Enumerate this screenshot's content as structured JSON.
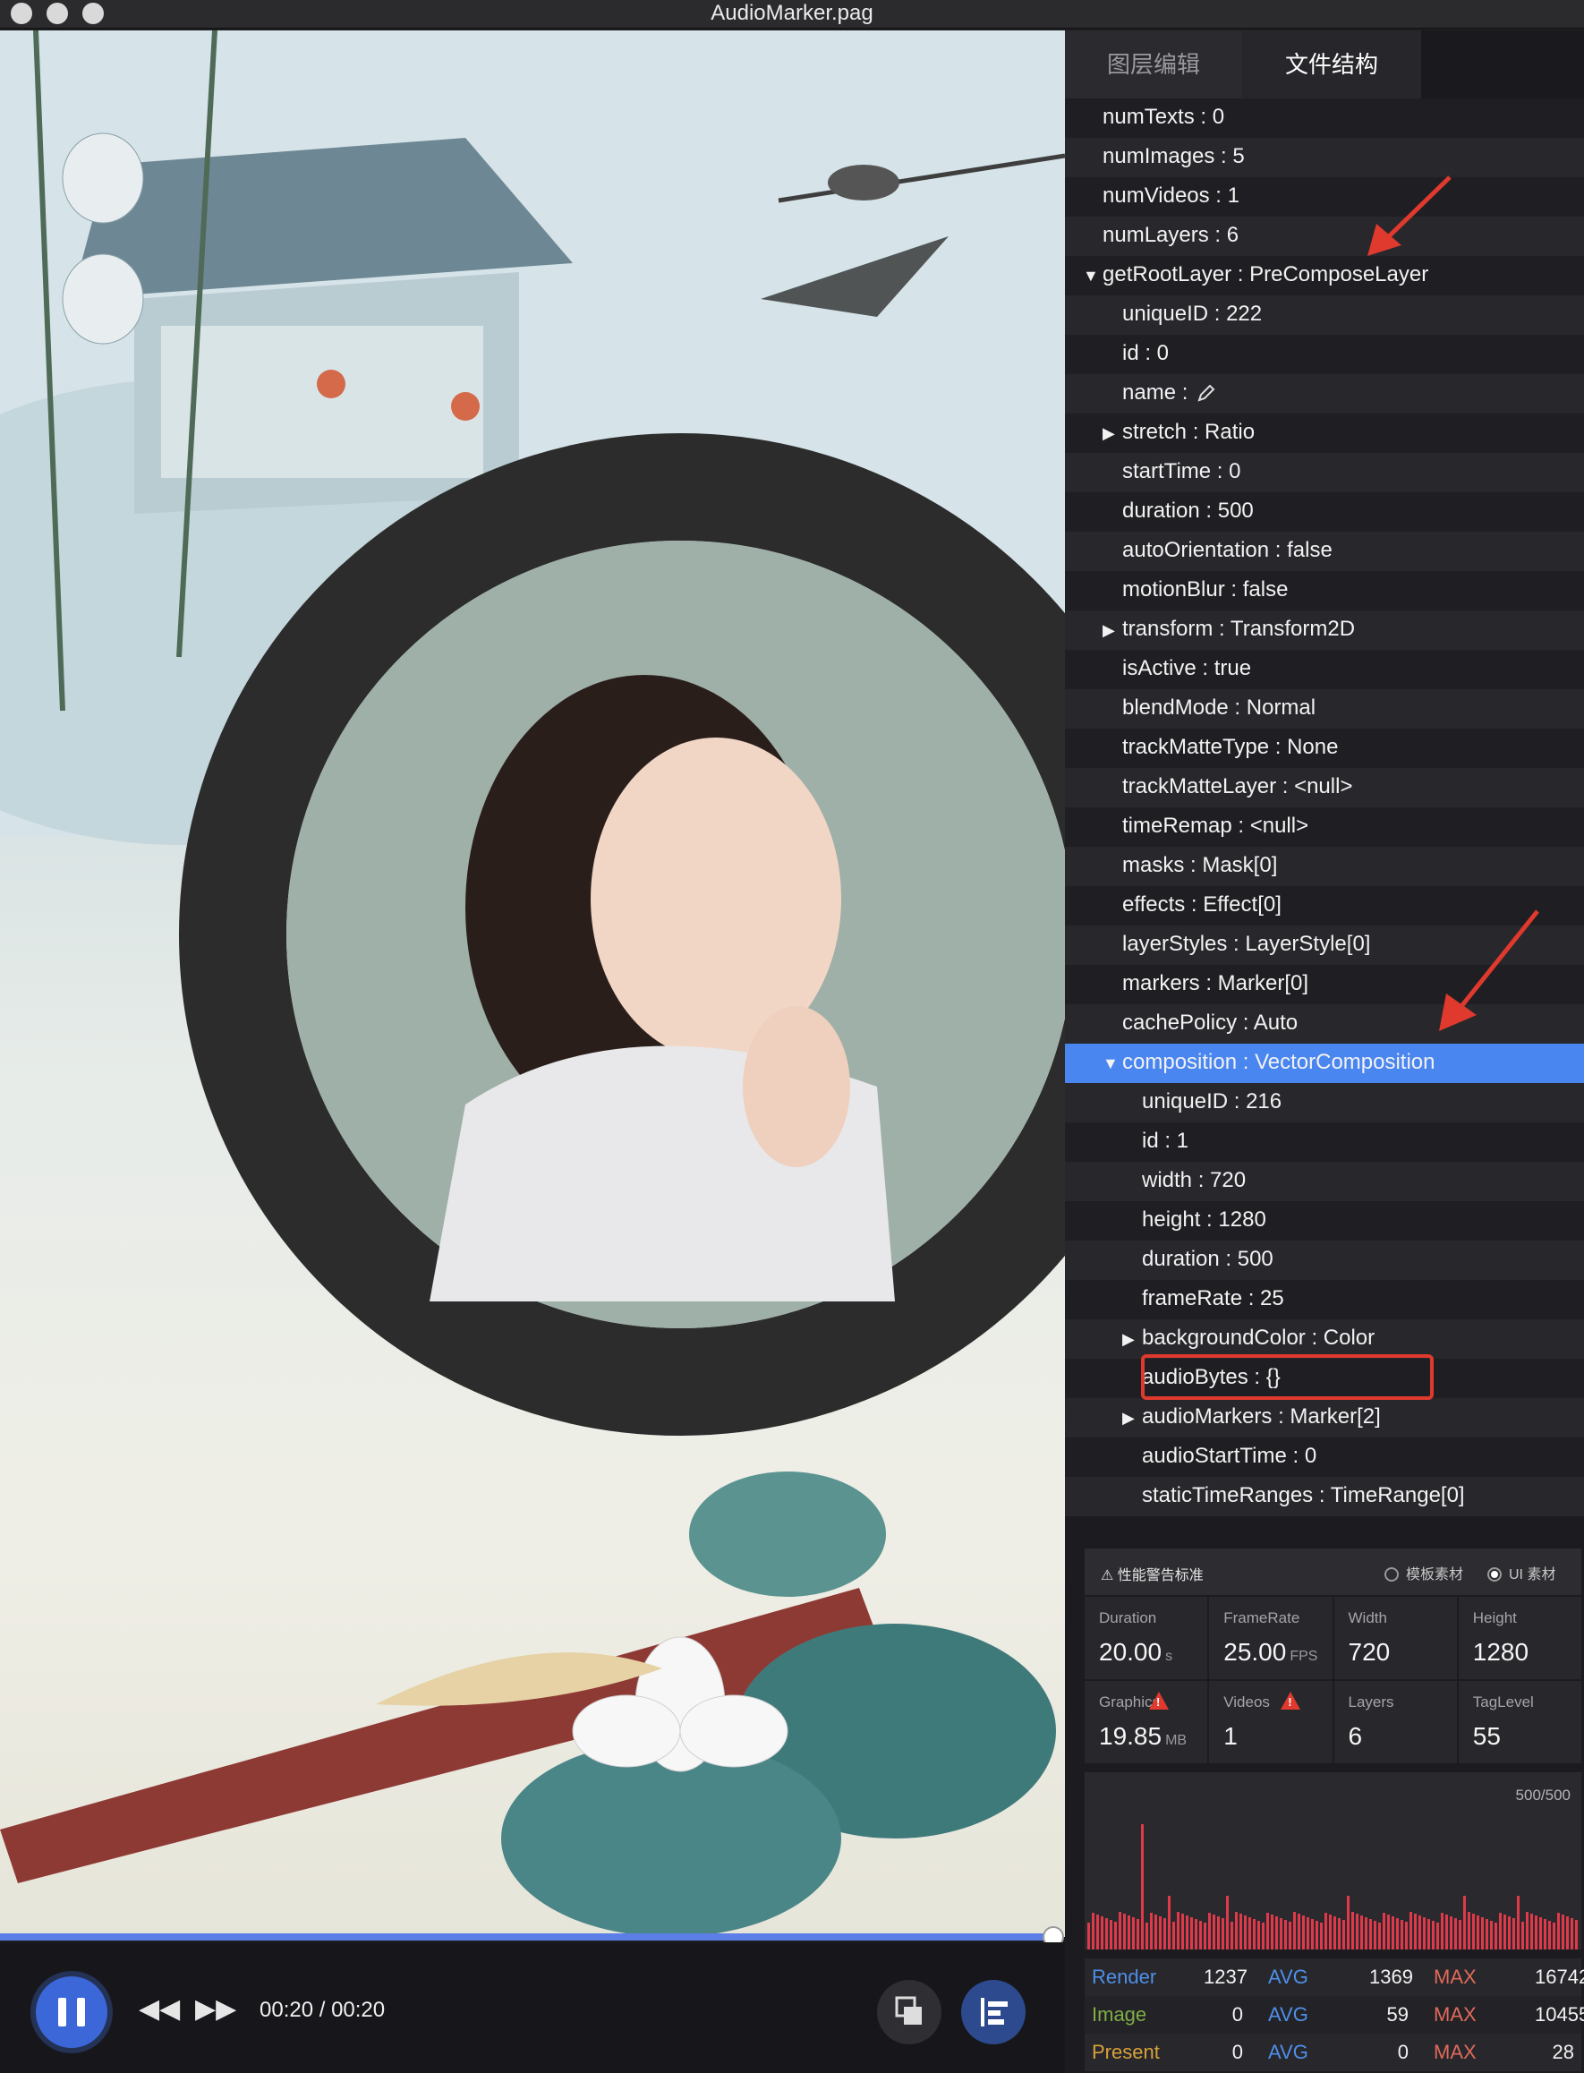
{
  "window": {
    "title": "AudioMarker.pag",
    "traffic_lights": [
      "close",
      "minimize",
      "zoom"
    ]
  },
  "player": {
    "time": "00:20 / 00:20",
    "progress_fraction": 1.0,
    "controls": [
      "pause-icon",
      "rewind-icon",
      "fast-forward-icon",
      "layers-icon",
      "align-icon"
    ]
  },
  "tabs": {
    "layer_edit": "图层编辑",
    "file_structure": "文件结构",
    "active": "file_structure"
  },
  "tree": [
    {
      "depth": 0,
      "arrow": "",
      "text": "numTexts : 0"
    },
    {
      "depth": 0,
      "arrow": "",
      "text": "numImages : 5"
    },
    {
      "depth": 0,
      "arrow": "",
      "text": "numVideos : 1"
    },
    {
      "depth": 0,
      "arrow": "",
      "text": "numLayers : 6"
    },
    {
      "depth": 0,
      "arrow": "▼",
      "text": "getRootLayer : PreComposeLayer"
    },
    {
      "depth": 1,
      "arrow": "",
      "text": "uniqueID : 222"
    },
    {
      "depth": 1,
      "arrow": "",
      "text": "id : 0"
    },
    {
      "depth": 1,
      "arrow": "",
      "text": "name :",
      "edit": true
    },
    {
      "depth": 1,
      "arrow": "▶",
      "text": "stretch : Ratio"
    },
    {
      "depth": 1,
      "arrow": "",
      "text": "startTime : 0"
    },
    {
      "depth": 1,
      "arrow": "",
      "text": "duration : 500"
    },
    {
      "depth": 1,
      "arrow": "",
      "text": "autoOrientation : false"
    },
    {
      "depth": 1,
      "arrow": "",
      "text": "motionBlur : false"
    },
    {
      "depth": 1,
      "arrow": "▶",
      "text": "transform : Transform2D"
    },
    {
      "depth": 1,
      "arrow": "",
      "text": "isActive : true"
    },
    {
      "depth": 1,
      "arrow": "",
      "text": "blendMode : Normal"
    },
    {
      "depth": 1,
      "arrow": "",
      "text": "trackMatteType : None"
    },
    {
      "depth": 1,
      "arrow": "",
      "text": "trackMatteLayer : <null>"
    },
    {
      "depth": 1,
      "arrow": "",
      "text": "timeRemap : <null>"
    },
    {
      "depth": 1,
      "arrow": "",
      "text": "masks : Mask[0]"
    },
    {
      "depth": 1,
      "arrow": "",
      "text": "effects : Effect[0]"
    },
    {
      "depth": 1,
      "arrow": "",
      "text": "layerStyles : LayerStyle[0]"
    },
    {
      "depth": 1,
      "arrow": "",
      "text": "markers : Marker[0]"
    },
    {
      "depth": 1,
      "arrow": "",
      "text": "cachePolicy : Auto"
    },
    {
      "depth": 1,
      "arrow": "▼",
      "text": "composition : VectorComposition",
      "selected": true
    },
    {
      "depth": 2,
      "arrow": "",
      "text": "uniqueID : 216"
    },
    {
      "depth": 2,
      "arrow": "",
      "text": "id : 1"
    },
    {
      "depth": 2,
      "arrow": "",
      "text": "width : 720"
    },
    {
      "depth": 2,
      "arrow": "",
      "text": "height : 1280"
    },
    {
      "depth": 2,
      "arrow": "",
      "text": "duration : 500"
    },
    {
      "depth": 2,
      "arrow": "",
      "text": "frameRate : 25"
    },
    {
      "depth": 2,
      "arrow": "▶",
      "text": "backgroundColor : Color"
    },
    {
      "depth": 2,
      "arrow": "",
      "text": "audioBytes : {}"
    },
    {
      "depth": 2,
      "arrow": "▶",
      "text": "audioMarkers : Marker[2]"
    },
    {
      "depth": 2,
      "arrow": "",
      "text": "audioStartTime : 0"
    },
    {
      "depth": 2,
      "arrow": "",
      "text": "staticTimeRanges : TimeRange[0]"
    }
  ],
  "stats": {
    "warning_label": "性能警告标准",
    "radio_template": "模板素材",
    "radio_ui": "UI 素材",
    "radio_selected": "ui",
    "cells": [
      {
        "key": "Duration",
        "value": "20.00",
        "unit": "s",
        "warn": false
      },
      {
        "key": "FrameRate",
        "value": "25.00",
        "unit": "FPS",
        "warn": false
      },
      {
        "key": "Width",
        "value": "720",
        "unit": "",
        "warn": false
      },
      {
        "key": "Height",
        "value": "1280",
        "unit": "",
        "warn": false
      },
      {
        "key": "Graphics",
        "value": "19.85",
        "unit": "MB",
        "warn": true
      },
      {
        "key": "Videos",
        "value": "1",
        "unit": "",
        "warn": true
      },
      {
        "key": "Layers",
        "value": "6",
        "unit": "",
        "warn": false
      },
      {
        "key": "TagLevel",
        "value": "55",
        "unit": "",
        "warn": false
      }
    ],
    "graph_caption": "500/500",
    "perf": [
      {
        "label": "Render",
        "value": "1237",
        "avg": "1369",
        "max": "16742",
        "color": "#4f8fe8"
      },
      {
        "label": "Image",
        "value": "0",
        "avg": "59",
        "max": "10455",
        "color": "#7fae45"
      },
      {
        "label": "Present",
        "value": "0",
        "avg": "0",
        "max": "28",
        "color": "#d8a23a"
      }
    ],
    "avg_label": "AVG",
    "max_label": "MAX"
  },
  "colors": {
    "accent": "#3c67d8",
    "selection": "#4a86f0",
    "annotation_red": "#e0392d",
    "graph_bar": "#e0394a"
  }
}
